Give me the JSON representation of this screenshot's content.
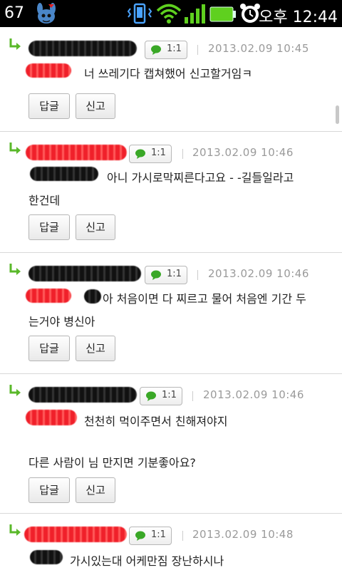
{
  "status_bar": {
    "notification_count": "67",
    "time": "오후 12:44"
  },
  "comments": [
    {
      "badge": "1:1",
      "date": "2013.02.09 10:45",
      "text": "너 쓰레기다 캡쳐했어 신고할거임ㅋ",
      "reply_label": "답글",
      "report_label": "신고"
    },
    {
      "badge": "1:1",
      "date": "2013.02.09 10:46",
      "text_line1": "아니 가시로막찌른다고요 - -길들일라고",
      "text_line2": "한건데",
      "reply_label": "답글",
      "report_label": "신고"
    },
    {
      "badge": "1:1",
      "date": "2013.02.09 10:46",
      "text_line1": "아 처음이면 다 찌르고 물어 처음엔 기간 두",
      "text_line2": "는거야 병신아",
      "reply_label": "답글",
      "report_label": "신고"
    },
    {
      "badge": "1:1",
      "date": "2013.02.09 10:46",
      "text_line1": "천천히 먹이주면서 친해져야지",
      "text_line2": "다른 사람이 님 만지면 기분좋아요?",
      "reply_label": "답글",
      "report_label": "신고"
    },
    {
      "badge": "1:1",
      "date": "2013.02.09 10:48",
      "text": "가시있는대 어케만짐 장난하시나"
    }
  ]
}
